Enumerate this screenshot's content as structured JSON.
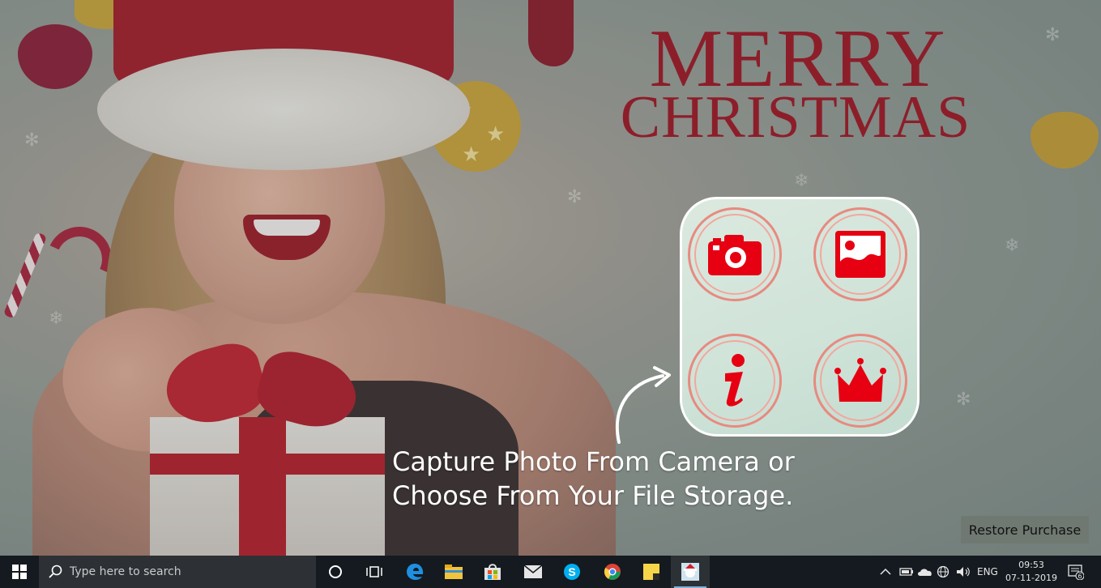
{
  "app": {
    "title_line1": "MERRY",
    "title_line2": "CHRISTMAS",
    "caption_line1": "Capture Photo From Camera or",
    "caption_line2": "Choose From Your File Storage.",
    "restore_label": "Restore Purchase",
    "tiles": [
      {
        "name": "camera",
        "icon": "camera-icon"
      },
      {
        "name": "gallery",
        "icon": "image-icon"
      },
      {
        "name": "info",
        "icon": "info-icon"
      },
      {
        "name": "premium",
        "icon": "crown-icon"
      }
    ],
    "accent_color": "#e60012"
  },
  "taskbar": {
    "search_placeholder": "Type here to search",
    "pinned_icons": [
      "cortana-icon",
      "task-view-icon",
      "edge-icon",
      "file-explorer-icon",
      "store-icon",
      "mail-icon",
      "skype-icon",
      "chrome-icon",
      "sticky-notes-icon",
      "christmas-app-icon"
    ],
    "language": "ENG",
    "time": "09:53",
    "date": "07-11-2019",
    "notification_count": "6"
  }
}
